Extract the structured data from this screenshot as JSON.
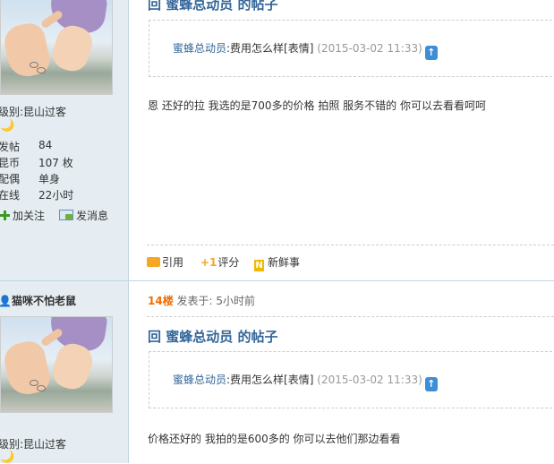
{
  "post1": {
    "title": "回 蜜蜂总动员 的帖子",
    "quote": {
      "author": "蜜蜂总动员",
      "text": ":费用怎么样[表情]",
      "date": "(2015-03-02 11:33)",
      "arrow_icon": "up-arrow-icon"
    },
    "body": "恩 还好的拉  我选的是700多的价格  拍照 服务不错的   你可以去看看呵呵",
    "actions": {
      "quote_label": "引用",
      "rate_label": "评分",
      "share_label": "新鲜事"
    },
    "user": {
      "level_label": "级别:",
      "level_value": "昆山过客",
      "stats": [
        {
          "label": "发帖",
          "value": "84"
        },
        {
          "label": "昆币",
          "value": "107 枚"
        },
        {
          "label": "配偶",
          "value": "单身"
        },
        {
          "label": "在线",
          "value": "22小时"
        }
      ],
      "follow_label": "加关注",
      "message_label": "发消息"
    }
  },
  "post2": {
    "username": "猫咪不怕老鼠",
    "floor": "14楼",
    "posted": "发表于: 5小时前",
    "title": "回 蜜蜂总动员 的帖子",
    "quote": {
      "author": "蜜蜂总动员",
      "text": ":费用怎么样[表情]",
      "date": "(2015-03-02 11:33)"
    },
    "body": "价格还好的 我拍的是600多的   你可以去他们那边看看",
    "user": {
      "level_label": "级别:",
      "level_value": "昆山过客"
    }
  },
  "colors": {
    "link": "#336699",
    "floor": "#f26c00",
    "sidebar_bg": "#e5edf2",
    "separator": "#c2d5e3"
  }
}
